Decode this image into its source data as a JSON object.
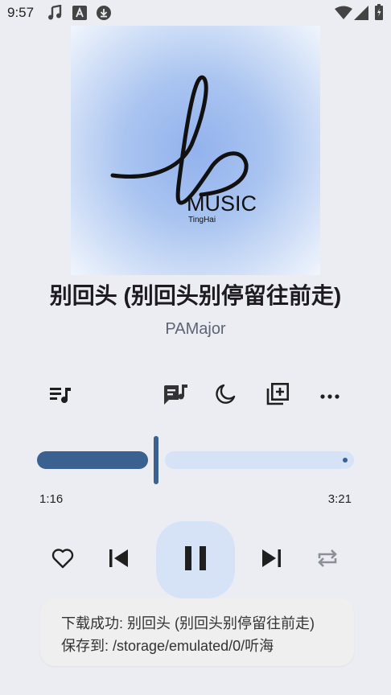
{
  "status_bar": {
    "time": "9:57",
    "left_icons": [
      "music-note-icon",
      "font-a-icon",
      "download-icon"
    ],
    "right_icons": [
      "wifi-icon",
      "signal-icon",
      "battery-icon"
    ]
  },
  "album_art": {
    "logo_word": "MUSIC",
    "logo_sub": "TingHai",
    "colors": {
      "center": "#9bb9ee",
      "edge": "#f3f7fd"
    }
  },
  "track": {
    "title": "别回头 (别回头别停留往前走)",
    "artist": "PAMajor"
  },
  "toolbar": {
    "items": [
      {
        "icon": "queue-music-icon"
      },
      {
        "icon": "lyrics-icon"
      },
      {
        "icon": "sleep-timer-moon-icon"
      },
      {
        "icon": "add-to-playlist-icon"
      },
      {
        "icon": "more-icon"
      }
    ]
  },
  "progress": {
    "current": "1:16",
    "total": "3:21",
    "fraction": 0.378,
    "colors": {
      "active": "#3b6190",
      "inactive": "#d6e3f7"
    }
  },
  "controls": {
    "icons": [
      "favorite-icon",
      "skip-previous-icon",
      "pause-icon",
      "skip-next-icon",
      "repeat-icon"
    ]
  },
  "toast": {
    "line1": "下载成功: 别回头 (别回头别停留往前走)",
    "line2": "保存到: /storage/emulated/0/听海"
  }
}
